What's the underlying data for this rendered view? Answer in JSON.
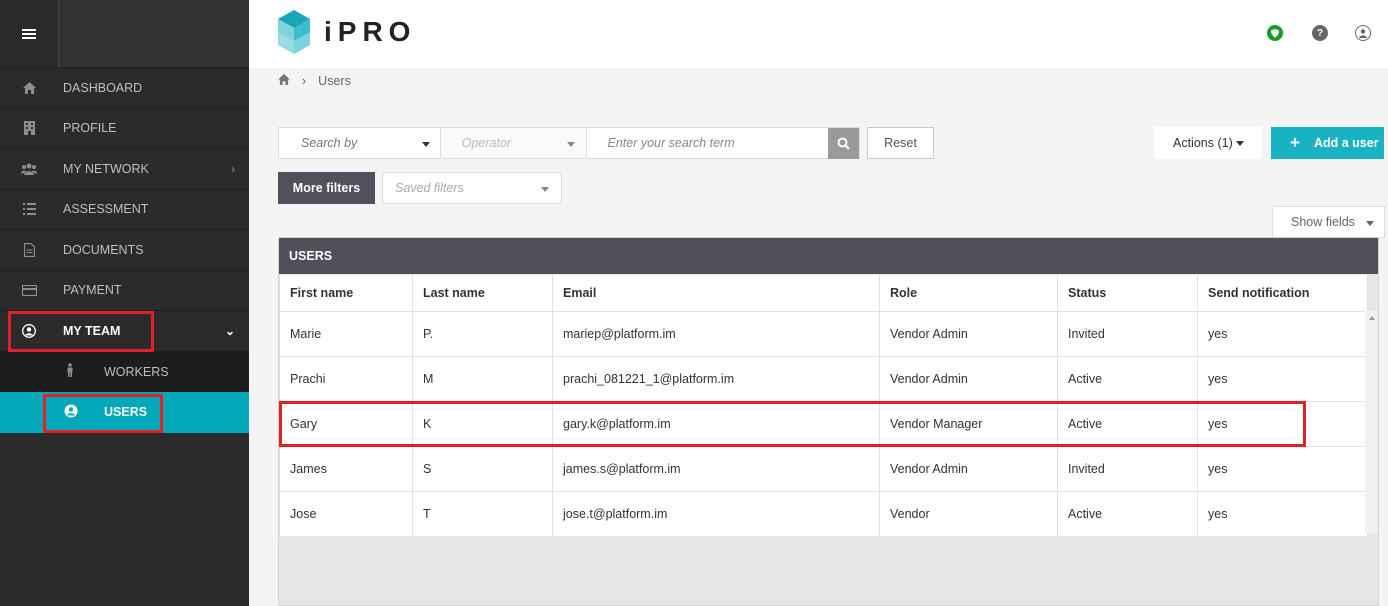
{
  "brand": {
    "name": "iPRO"
  },
  "sidebar": {
    "items": [
      {
        "label": "DASHBOARD",
        "icon": "home-icon"
      },
      {
        "label": "PROFILE",
        "icon": "building-icon"
      },
      {
        "label": "MY NETWORK",
        "icon": "users-icon"
      },
      {
        "label": "ASSESSMENT",
        "icon": "list-icon"
      },
      {
        "label": "DOCUMENTS",
        "icon": "document-icon"
      },
      {
        "label": "PAYMENT",
        "icon": "credit-card-icon"
      },
      {
        "label": "MY TEAM",
        "icon": "user-circle-icon"
      }
    ],
    "sub_items": [
      {
        "label": "WORKERS",
        "icon": "person-icon"
      },
      {
        "label": "USERS",
        "icon": "user-circle-icon"
      }
    ]
  },
  "breadcrumb": {
    "current": "Users"
  },
  "search": {
    "search_by": "Search by",
    "operator": "Operator",
    "term_placeholder": "Enter your search term"
  },
  "toolbar": {
    "reset": "Reset",
    "actions": "Actions (1)",
    "add_user": "Add a user",
    "more_filters": "More filters",
    "saved_filters": "Saved filters",
    "show_fields": "Show fields"
  },
  "table": {
    "title": "USERS",
    "columns": [
      "First name",
      "Last name",
      "Email",
      "Role",
      "Status",
      "Send notification"
    ],
    "rows": [
      [
        "Marie",
        "P.",
        "mariep@platform.im",
        "Vendor Admin",
        "Invited",
        "yes"
      ],
      [
        "Prachi",
        "M",
        "prachi_081221_1@platform.im",
        "Vendor Admin",
        "Active",
        "yes"
      ],
      [
        "Gary",
        "K",
        "gary.k@platform.im",
        "Vendor Manager",
        "Active",
        "yes"
      ],
      [
        "James",
        "S",
        "james.s@platform.im",
        "Vendor Admin",
        "Invited",
        "yes"
      ],
      [
        "Jose",
        "T",
        "jose.t@platform.im",
        "Vendor",
        "Active",
        "yes"
      ]
    ]
  },
  "colors": {
    "accent": "#19b2c3",
    "selected": "#00a8b8",
    "highlight": "#e0202b",
    "table_header": "#4f5059"
  }
}
